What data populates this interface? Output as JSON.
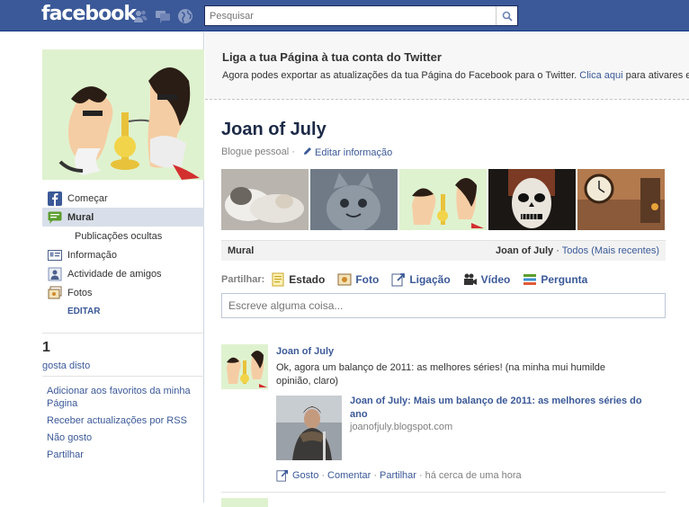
{
  "topbar": {
    "logo": "facebook",
    "search_placeholder": "Pesquisar",
    "jewels": [
      "friend-requests-icon",
      "messages-icon",
      "notifications-icon"
    ],
    "colors": {
      "bar": "#3b5998",
      "link": "#3b5998"
    }
  },
  "sidebar": {
    "nav": [
      {
        "label": "Começar",
        "icon": "facebook-f-icon"
      },
      {
        "label": "Mural",
        "icon": "speech-bubble-icon",
        "active": true
      },
      {
        "label": "Publicações ocultas",
        "sub": true
      },
      {
        "label": "Informação",
        "icon": "info-card-icon"
      },
      {
        "label": "Actividade de amigos",
        "icon": "friends-activity-icon"
      },
      {
        "label": "Fotos",
        "icon": "photos-icon"
      }
    ],
    "edit_label": "EDITAR",
    "likes_count": "1",
    "likes_text": "gosta disto",
    "actions": [
      "Adicionar aos favoritos da minha Página",
      "Receber actualizações por RSS",
      "Não gosto",
      "Partilhar"
    ]
  },
  "twitter_banner": {
    "title": "Liga a tua Página à tua conta do Twitter",
    "text": "Agora podes exportar as atualizações da tua Página do Facebook para o Twitter.",
    "link": "Clica aqui",
    "text_after": "para ativares es"
  },
  "page": {
    "name": "Joan of July",
    "category": "Blogue pessoal",
    "category_sep": "·",
    "edit_info": "Editar informação"
  },
  "wall": {
    "title": "Mural",
    "owner": "Joan of July",
    "sep": "·",
    "filter": "Todos (Mais recentes)"
  },
  "share": {
    "label": "Partilhar:",
    "options": [
      {
        "label": "Estado",
        "icon": "status-note-icon",
        "active": true
      },
      {
        "label": "Foto",
        "icon": "photo-icon"
      },
      {
        "label": "Ligação",
        "icon": "link-icon"
      },
      {
        "label": "Vídeo",
        "icon": "video-camera-icon"
      },
      {
        "label": "Pergunta",
        "icon": "question-list-icon"
      }
    ],
    "composer_placeholder": "Escreve alguma coisa..."
  },
  "story": {
    "author": "Joan of July",
    "text": "Ok, agora um balanço de 2011: as melhores séries! (na minha mui humilde opinião, claro)",
    "attachment": {
      "title": "Joan of July: Mais um balanço de 2011: as melhores séries do ano",
      "url": "joanofjuly.blogspot.com"
    },
    "actions": {
      "like": "Gosto",
      "comment": "Comentar",
      "share": "Partilhar",
      "time": "há cerca de uma hora",
      "sep": "·"
    }
  }
}
